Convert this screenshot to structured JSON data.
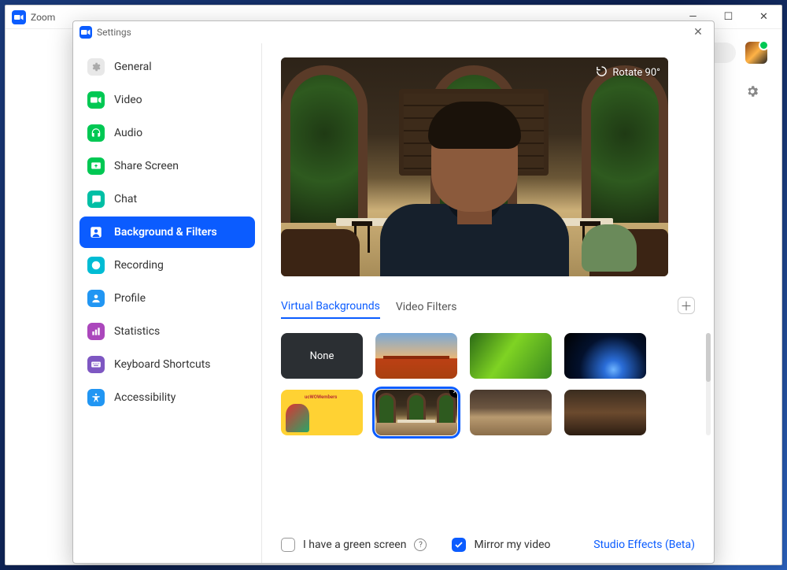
{
  "mainWindow": {
    "title": "Zoom"
  },
  "winControls": {
    "min": "—",
    "max": "☐",
    "close": "✕"
  },
  "settings": {
    "title": "Settings",
    "close": "✕"
  },
  "sidebar": {
    "items": [
      {
        "label": "General"
      },
      {
        "label": "Video"
      },
      {
        "label": "Audio"
      },
      {
        "label": "Share Screen"
      },
      {
        "label": "Chat"
      },
      {
        "label": "Background & Filters"
      },
      {
        "label": "Recording"
      },
      {
        "label": "Profile"
      },
      {
        "label": "Statistics"
      },
      {
        "label": "Keyboard Shortcuts"
      },
      {
        "label": "Accessibility"
      }
    ],
    "activeIndex": 5
  },
  "preview": {
    "rotateLabel": "Rotate 90°"
  },
  "tabs": {
    "items": [
      "Virtual Backgrounds",
      "Video Filters"
    ],
    "activeIndex": 0,
    "addTooltip": "Add Image or Video"
  },
  "thumbnails": {
    "noneLabel": "None",
    "items": [
      {
        "type": "none",
        "name": "none"
      },
      {
        "type": "bridge",
        "name": "golden-gate-bridge"
      },
      {
        "type": "grass",
        "name": "grass"
      },
      {
        "type": "space",
        "name": "earth-from-space"
      },
      {
        "type": "yellow",
        "name": "ucwowembers-promo"
      },
      {
        "type": "cafe",
        "name": "cafe-greenwall",
        "selected": true,
        "removable": true
      },
      {
        "type": "loft",
        "name": "loft-lounge"
      },
      {
        "type": "resto",
        "name": "restaurant-bar"
      }
    ]
  },
  "footer": {
    "greenScreen": {
      "label": "I have a green screen",
      "checked": false
    },
    "mirror": {
      "label": "Mirror my video",
      "checked": true
    },
    "studioLink": "Studio Effects (Beta)"
  }
}
